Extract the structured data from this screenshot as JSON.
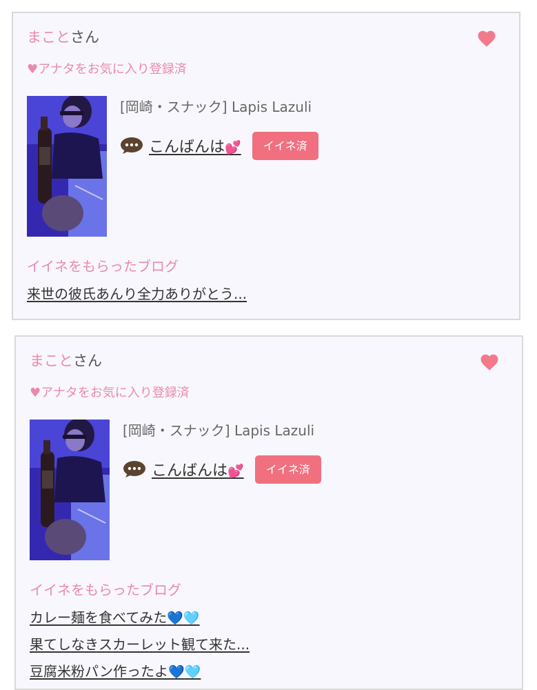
{
  "cards": [
    {
      "user_name": "まこと",
      "honorific": "さん",
      "favorite_status": "♥アナタをお気に入り登録済",
      "shop": "[岡崎・スナック]  Lapis Lazuli",
      "comment": "こんばんは",
      "comment_emoji": "💕",
      "like_badge": "イイネ済",
      "blog_heading": "イイネをもらったブログ",
      "blogs": [
        {
          "title": "来世の彼氏あんり全力ありがとう...",
          "emoji": []
        }
      ]
    },
    {
      "user_name": "まこと",
      "honorific": "さん",
      "favorite_status": "♥アナタをお気に入り登録済",
      "shop": "[岡崎・スナック]  Lapis Lazuli",
      "comment": "こんばんは",
      "comment_emoji": "💕",
      "like_badge": "イイネ済",
      "blog_heading": "イイネをもらったブログ",
      "blogs": [
        {
          "title": "カレー麺を食べてみた",
          "emoji": [
            "💙",
            "🩵"
          ]
        },
        {
          "title": "果てしなきスカーレット観て来た...",
          "emoji": []
        },
        {
          "title": "豆腐米粉パン作ったよ",
          "emoji": [
            "💙",
            "🩵"
          ]
        }
      ]
    }
  ],
  "colors": {
    "accent_pink": "#ea8aab",
    "badge_red": "#f0707f",
    "heart_pink": "#f37a8b",
    "card_background": "#f8f7fd",
    "card_border": "#d9d9d9"
  },
  "icons": {
    "favorite": "heart-icon",
    "comment": "speech-bubble-icon"
  }
}
